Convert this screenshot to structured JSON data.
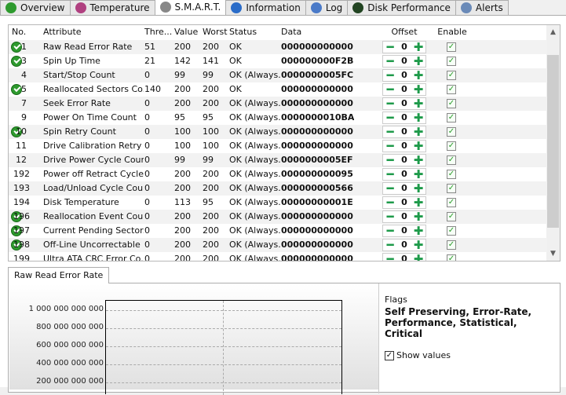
{
  "tabs": [
    {
      "label": "Overview",
      "icon": "check-circle-icon",
      "color": "#2e9a2e"
    },
    {
      "label": "Temperature",
      "icon": "thermometer-icon",
      "color": "#b04080"
    },
    {
      "label": "S.M.A.R.T.",
      "icon": "disk-icon",
      "color": "#888888",
      "active": true
    },
    {
      "label": "Information",
      "icon": "info-icon",
      "color": "#2a6cc8"
    },
    {
      "label": "Log",
      "icon": "log-icon",
      "color": "#4a7ac8"
    },
    {
      "label": "Disk Performance",
      "icon": "speedometer-icon",
      "color": "#224422"
    },
    {
      "label": "Alerts",
      "icon": "alerts-icon",
      "color": "#6a8ab8"
    }
  ],
  "table": {
    "headers": [
      "No.",
      "Attribute",
      "Thre...",
      "Value",
      "Worst",
      "Status",
      "Data",
      "Offset",
      "Enable"
    ],
    "rows": [
      {
        "no": "1",
        "attr": "Raw Read Error Rate",
        "thr": "51",
        "val": "200",
        "worst": "200",
        "status": "OK",
        "data": "000000000000",
        "offset": "0",
        "ok": true
      },
      {
        "no": "3",
        "attr": "Spin Up Time",
        "thr": "21",
        "val": "142",
        "worst": "141",
        "status": "OK",
        "data": "000000000F2B",
        "offset": "0",
        "ok": true
      },
      {
        "no": "4",
        "attr": "Start/Stop Count",
        "thr": "0",
        "val": "99",
        "worst": "99",
        "status": "OK (Always...",
        "data": "0000000005FC",
        "offset": "0",
        "ok": false
      },
      {
        "no": "5",
        "attr": "Reallocated Sectors Co...",
        "thr": "140",
        "val": "200",
        "worst": "200",
        "status": "OK",
        "data": "000000000000",
        "offset": "0",
        "ok": true
      },
      {
        "no": "7",
        "attr": "Seek Error Rate",
        "thr": "0",
        "val": "200",
        "worst": "200",
        "status": "OK (Always...",
        "data": "000000000000",
        "offset": "0",
        "ok": false
      },
      {
        "no": "9",
        "attr": "Power On Time Count",
        "thr": "0",
        "val": "95",
        "worst": "95",
        "status": "OK (Always...",
        "data": "0000000010BA",
        "offset": "0",
        "ok": false
      },
      {
        "no": "10",
        "attr": "Spin Retry Count",
        "thr": "0",
        "val": "100",
        "worst": "100",
        "status": "OK (Always...",
        "data": "000000000000",
        "offset": "0",
        "ok": true
      },
      {
        "no": "11",
        "attr": "Drive Calibration Retry ...",
        "thr": "0",
        "val": "100",
        "worst": "100",
        "status": "OK (Always...",
        "data": "000000000000",
        "offset": "0",
        "ok": false
      },
      {
        "no": "12",
        "attr": "Drive Power Cycle Count",
        "thr": "0",
        "val": "99",
        "worst": "99",
        "status": "OK (Always...",
        "data": "0000000005EF",
        "offset": "0",
        "ok": false
      },
      {
        "no": "192",
        "attr": "Power off Retract Cycle ...",
        "thr": "0",
        "val": "200",
        "worst": "200",
        "status": "OK (Always...",
        "data": "000000000095",
        "offset": "0",
        "ok": false
      },
      {
        "no": "193",
        "attr": "Load/Unload Cycle Cou...",
        "thr": "0",
        "val": "200",
        "worst": "200",
        "status": "OK (Always...",
        "data": "000000000566",
        "offset": "0",
        "ok": false
      },
      {
        "no": "194",
        "attr": "Disk Temperature",
        "thr": "0",
        "val": "113",
        "worst": "95",
        "status": "OK (Always...",
        "data": "00000000001E",
        "offset": "0",
        "ok": false
      },
      {
        "no": "196",
        "attr": "Reallocation Event Count",
        "thr": "0",
        "val": "200",
        "worst": "200",
        "status": "OK (Always...",
        "data": "000000000000",
        "offset": "0",
        "ok": true
      },
      {
        "no": "197",
        "attr": "Current Pending Sector...",
        "thr": "0",
        "val": "200",
        "worst": "200",
        "status": "OK (Always...",
        "data": "000000000000",
        "offset": "0",
        "ok": true
      },
      {
        "no": "198",
        "attr": "Off-Line Uncorrectable ...",
        "thr": "0",
        "val": "200",
        "worst": "200",
        "status": "OK (Always...",
        "data": "000000000000",
        "offset": "0",
        "ok": true
      },
      {
        "no": "199",
        "attr": "Ultra ATA CRC Error Co...",
        "thr": "0",
        "val": "200",
        "worst": "200",
        "status": "OK (Always...",
        "data": "000000000000",
        "offset": "0",
        "ok": false
      }
    ]
  },
  "detail": {
    "tab_label": "Raw Read Error Rate",
    "flags_label": "Flags",
    "flags_value": "Self Preserving, Error-Rate, Performance, Statistical, Critical",
    "show_values_label": "Show values",
    "show_values_checked": true
  },
  "chart_data": {
    "type": "line",
    "y_ticks": [
      "1 000 000 000 000",
      "800 000 000 000",
      "600 000 000 000",
      "400 000 000 000",
      "200 000 000 000"
    ],
    "grid": true
  }
}
